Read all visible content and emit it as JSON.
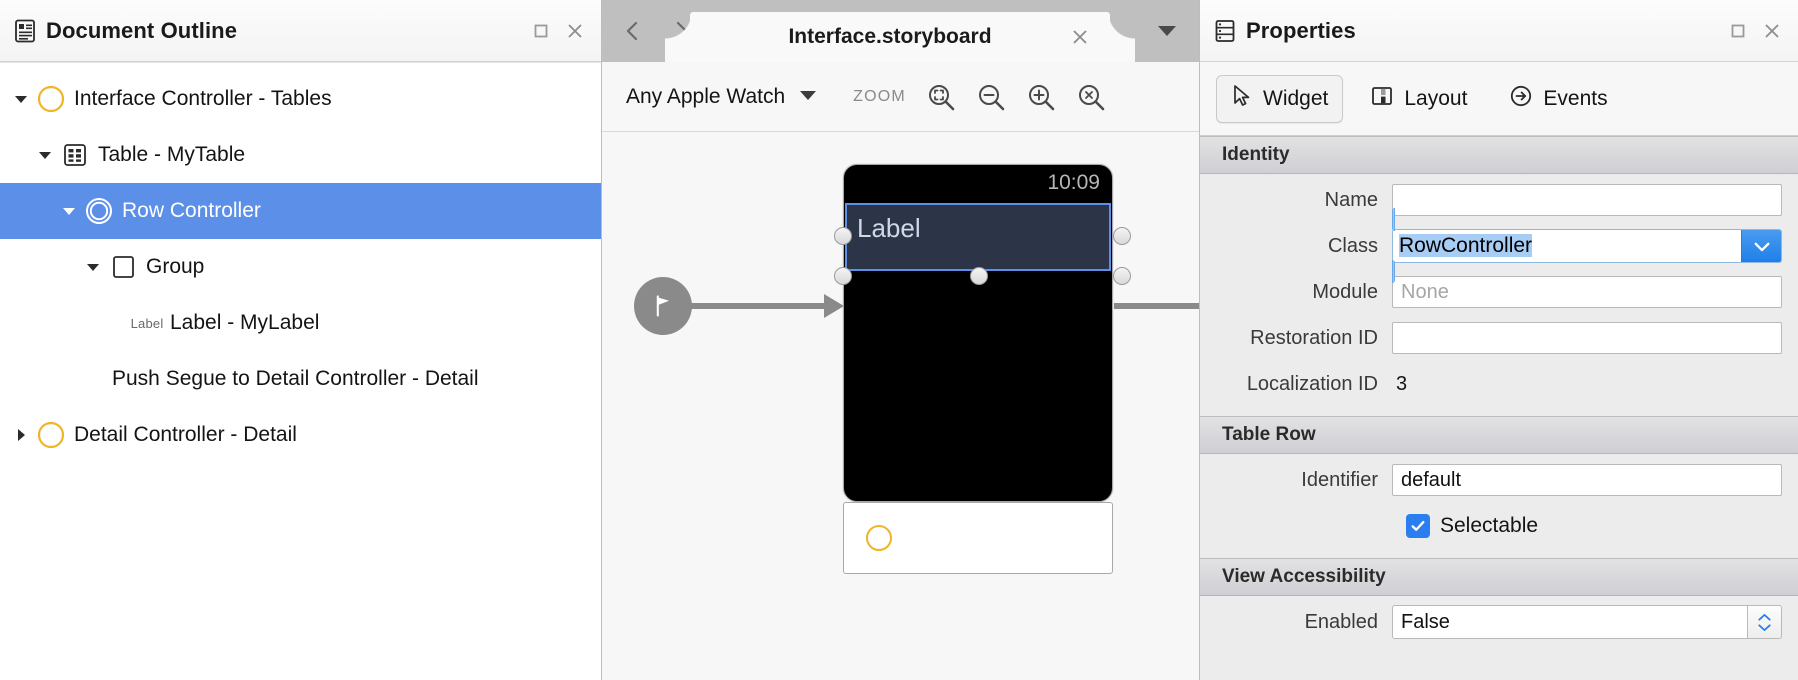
{
  "outline": {
    "title": "Document Outline",
    "icon": "document-outline-icon",
    "window_buttons": {
      "maximize": "maximize-icon",
      "close": "close-icon"
    },
    "items": [
      {
        "label": "Interface Controller - Tables",
        "icon": "controller-circle-icon",
        "disclosure": "expanded",
        "depth": 0,
        "selected": false
      },
      {
        "label": "Table - MyTable",
        "icon": "table-icon",
        "disclosure": "expanded",
        "depth": 1,
        "selected": false
      },
      {
        "label": "Row Controller",
        "icon": "row-controller-icon",
        "disclosure": "expanded",
        "depth": 2,
        "selected": true
      },
      {
        "label": "Group",
        "icon": "group-square-icon",
        "disclosure": "expanded",
        "depth": 3,
        "selected": false
      },
      {
        "label": "Label - MyLabel",
        "icon": "label-text-icon",
        "icon_text": "Label",
        "disclosure": "none",
        "depth": 4,
        "selected": false
      },
      {
        "label": "Push Segue to Detail Controller - Detail",
        "icon": "none",
        "disclosure": "none",
        "depth": 3,
        "selected": false
      },
      {
        "label": "Detail Controller - Detail",
        "icon": "controller-circle-icon",
        "disclosure": "collapsed",
        "depth": 0,
        "selected": false
      }
    ]
  },
  "editor": {
    "nav": {
      "back": "chevron-left-icon",
      "forward": "chevron-right-icon"
    },
    "tab": {
      "title": "Interface.storyboard",
      "close": "close-icon"
    },
    "tab_menu": "chevron-down-icon",
    "device": {
      "name": "Any Apple Watch",
      "caret": "chevron-down-icon"
    },
    "zoom": {
      "label": "ZOOM",
      "buttons": [
        {
          "name": "zoom-actual-size-icon"
        },
        {
          "name": "zoom-out-icon"
        },
        {
          "name": "zoom-in-icon"
        },
        {
          "name": "zoom-to-fit-icon"
        }
      ]
    },
    "canvas": {
      "watch_time": "10:09",
      "selected_element_text": "Label",
      "entry_point_icon": "entry-point-flag-icon"
    }
  },
  "properties": {
    "title": "Properties",
    "icon": "properties-icon",
    "window_buttons": {
      "maximize": "maximize-icon",
      "close": "close-icon"
    },
    "tabs": [
      {
        "label": "Widget",
        "icon": "cursor-arrow-icon",
        "active": true
      },
      {
        "label": "Layout",
        "icon": "layout-panes-icon",
        "active": false
      },
      {
        "label": "Events",
        "icon": "arrow-circle-icon",
        "active": false
      }
    ],
    "sections": [
      {
        "header": "Identity",
        "fields": [
          {
            "label": "Name",
            "type": "text",
            "value": "",
            "placeholder": ""
          },
          {
            "label": "Class",
            "type": "combo",
            "value": "RowController",
            "focused": true,
            "selected_text": true
          },
          {
            "label": "Module",
            "type": "text",
            "value": "",
            "placeholder": "None"
          },
          {
            "label": "Restoration ID",
            "type": "text",
            "value": "",
            "placeholder": ""
          },
          {
            "label": "Localization ID",
            "type": "static",
            "value": "3"
          }
        ]
      },
      {
        "header": "Table Row",
        "fields": [
          {
            "label": "Identifier",
            "type": "text",
            "value": "default",
            "placeholder": ""
          },
          {
            "label": "",
            "type": "checkbox",
            "value": "Selectable",
            "checked": true
          }
        ]
      },
      {
        "header": "View Accessibility",
        "fields": [
          {
            "label": "Enabled",
            "type": "stepper",
            "value": "False"
          }
        ]
      }
    ]
  },
  "colors": {
    "selection_blue": "#5b8fe8",
    "accent_yellow": "#f0b429",
    "focus_ring": "#9fc8f5",
    "checkbox_blue": "#2a7ef0"
  }
}
